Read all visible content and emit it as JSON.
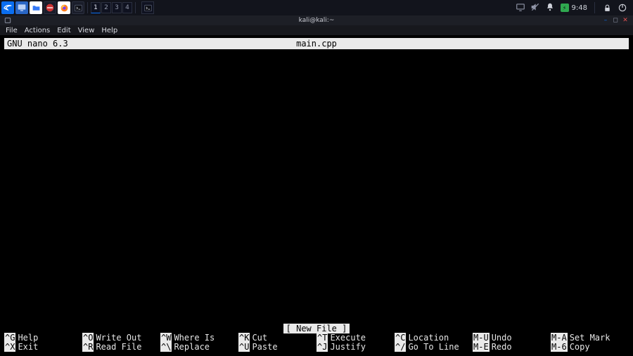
{
  "taskbar": {
    "workspaces": [
      "1",
      "2",
      "3",
      "4"
    ],
    "active_workspace": 0,
    "clock": "9:48"
  },
  "window": {
    "title": "kali@kali:~"
  },
  "menubar": [
    "File",
    "Actions",
    "Edit",
    "View",
    "Help"
  ],
  "nano": {
    "version": "GNU nano 6.3",
    "filename": "main.cpp",
    "status": "[ New File ]",
    "shortcuts": [
      [
        {
          "key": "^G",
          "label": "Help"
        },
        {
          "key": "^X",
          "label": "Exit"
        }
      ],
      [
        {
          "key": "^O",
          "label": "Write Out"
        },
        {
          "key": "^R",
          "label": "Read File"
        }
      ],
      [
        {
          "key": "^W",
          "label": "Where Is"
        },
        {
          "key": "^\\",
          "label": "Replace"
        }
      ],
      [
        {
          "key": "^K",
          "label": "Cut"
        },
        {
          "key": "^U",
          "label": "Paste"
        }
      ],
      [
        {
          "key": "^T",
          "label": "Execute"
        },
        {
          "key": "^J",
          "label": "Justify"
        }
      ],
      [
        {
          "key": "^C",
          "label": "Location"
        },
        {
          "key": "^/",
          "label": "Go To Line"
        }
      ],
      [
        {
          "key": "M-U",
          "label": "Undo"
        },
        {
          "key": "M-E",
          "label": "Redo"
        }
      ],
      [
        {
          "key": "M-A",
          "label": "Set Mark"
        },
        {
          "key": "M-6",
          "label": "Copy"
        }
      ]
    ]
  }
}
